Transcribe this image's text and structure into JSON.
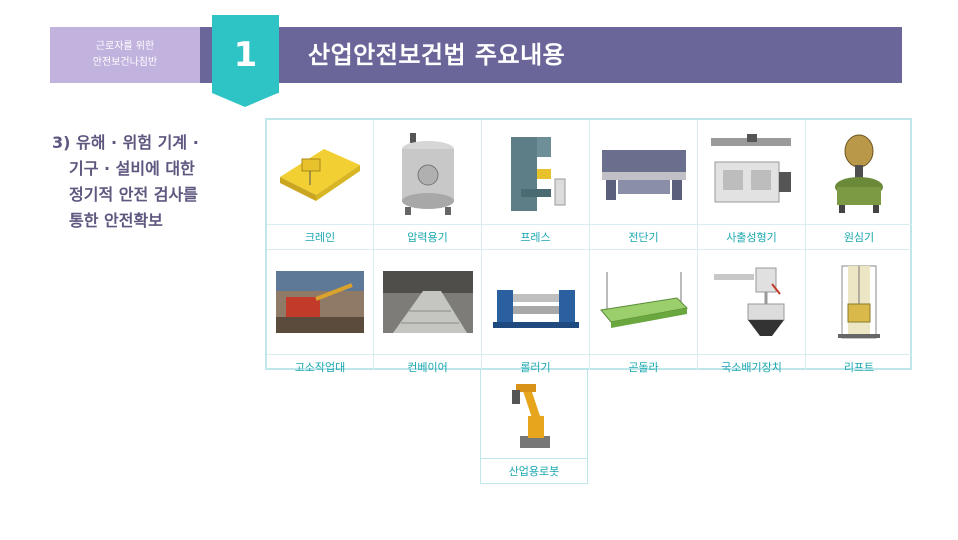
{
  "badge": {
    "line1": "근로자를 위한",
    "line2": "안전보건나침반"
  },
  "section_number": "1",
  "title": "산업안전보건법 주요내용",
  "heading": {
    "line1": "3) 유해 · 위험 기계 ·",
    "line2": "기구 · 설비에 대한",
    "line3": "정기적 안전 검사를",
    "line4": "통한 안전확보"
  },
  "machines": [
    {
      "label": "크레인",
      "icon": "crane-image"
    },
    {
      "label": "압력용기",
      "icon": "pressure-vessel-image"
    },
    {
      "label": "프레스",
      "icon": "press-image"
    },
    {
      "label": "전단기",
      "icon": "shearing-machine-image"
    },
    {
      "label": "사출성형기",
      "icon": "injection-molding-image"
    },
    {
      "label": "원심기",
      "icon": "centrifuge-image"
    },
    {
      "label": "고소작업대",
      "icon": "aerial-work-platform-image"
    },
    {
      "label": "컨베이어",
      "icon": "conveyor-image"
    },
    {
      "label": "롤러기",
      "icon": "roller-image"
    },
    {
      "label": "곤돌라",
      "icon": "gondola-image"
    },
    {
      "label": "국소배기장치",
      "icon": "local-exhaust-image"
    },
    {
      "label": "리프트",
      "icon": "lift-image"
    },
    {
      "label": "산업용로봇",
      "icon": "industrial-robot-image"
    }
  ],
  "colors": {
    "title_bar": "#6a6699",
    "badge": "#c2b2de",
    "accent": "#2ec3c4",
    "label": "#1aa7b0",
    "heading": "#5f577f"
  }
}
